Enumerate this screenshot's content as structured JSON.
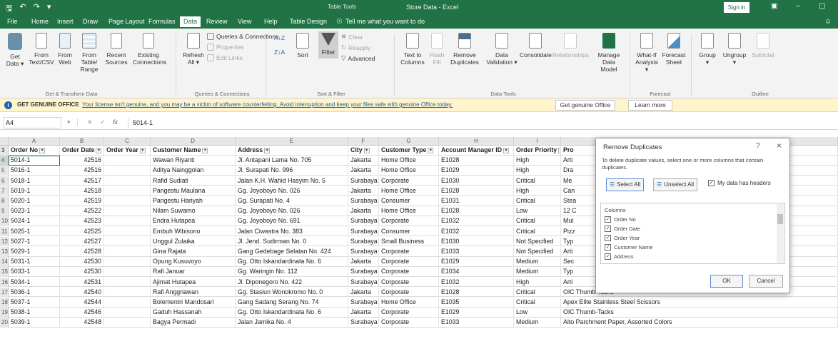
{
  "titlebar": {
    "table_tools": "Table Tools",
    "title": "Store Data - Excel",
    "sign_in": "Sign in"
  },
  "tabs": [
    "File",
    "Home",
    "Insert",
    "Draw",
    "Page Layout",
    "Formulas",
    "Data",
    "Review",
    "View",
    "Help",
    "Table Design"
  ],
  "active_tab": "Data",
  "tell_me": "Tell me what you want to do",
  "ribbon": {
    "get_data": "Get Data",
    "from_text": "From Text/CSV",
    "from_web": "From Web",
    "from_table": "From Table/ Range",
    "recent_sources": "Recent Sources",
    "existing_conn": "Existing Connections",
    "group_get": "Get & Transform Data",
    "refresh_all": "Refresh All",
    "queries_conn": "Queries & Connections",
    "properties": "Properties",
    "edit_links": "Edit Links",
    "group_queries": "Queries & Connections",
    "sort": "Sort",
    "filter": "Filter",
    "clear": "Clear",
    "reapply": "Reapply",
    "advanced": "Advanced",
    "group_sort": "Sort & Filter",
    "text_to_columns": "Text to Columns",
    "flash_fill": "Flash Fill",
    "remove_duplicates": "Remove Duplicates",
    "data_validation": "Data Validation",
    "consolidate": "Consolidate",
    "relationships": "Relationships",
    "manage_model": "Manage Data Model",
    "group_tools": "Data Tools",
    "what_if": "What-If Analysis",
    "forecast_sheet": "Forecast Sheet",
    "group_forecast": "Forecast",
    "group_btn": "Group",
    "ungroup": "Ungroup",
    "subtotal": "Subtotal",
    "group_outline": "Outline"
  },
  "message_bar": {
    "label": "GET GENUINE OFFICE",
    "text": "Your license isn't genuine, and you may be a victim of software counterfeiting. Avoid interruption and keep your files safe with genuine Office today.",
    "btn_genuine": "Get genuine Office",
    "btn_learn": "Learn more"
  },
  "formula_bar": {
    "name_box": "A4",
    "fx": "fx",
    "value": "5014-1"
  },
  "column_letters": [
    "A",
    "B",
    "C",
    "D",
    "E",
    "F",
    "G",
    "H",
    "I",
    "J"
  ],
  "headers": [
    "Order No",
    "Order Date",
    "Order Year",
    "Customer Name",
    "Address",
    "City",
    "Customer Type",
    "Account Manager ID",
    "Order Priority",
    "Pro"
  ],
  "rows": [
    {
      "n": "4",
      "c": [
        "5014-1",
        "42516",
        "",
        "Wawan Riyanti",
        "Jl. Antapani Lama No. 705",
        "Jakarta",
        "Home Office",
        "E1028",
        "High",
        "Arti"
      ]
    },
    {
      "n": "5",
      "c": [
        "5016-1",
        "42516",
        "",
        "Aditya Nainggolan",
        "Jl. Surapati No. 996",
        "Jakarta",
        "Home Office",
        "E1029",
        "High",
        "Dra"
      ]
    },
    {
      "n": "6",
      "c": [
        "5018-1",
        "42517",
        "",
        "Rafid Sudiati",
        "Jalan K.H. Wahid Hasyim No. 5",
        "Surabaya",
        "Corporate",
        "E1030",
        "Critical",
        "Me"
      ]
    },
    {
      "n": "7",
      "c": [
        "5019-1",
        "42518",
        "",
        "Pangestu Maulana",
        "Gg. Joyoboyo No. 026",
        "Jakarta",
        "Home Office",
        "E1028",
        "High",
        "Can"
      ]
    },
    {
      "n": "8",
      "c": [
        "5020-1",
        "42519",
        "",
        "Pangestu Hariyah",
        "Gg. Surapati No. 4",
        "Surabaya",
        "Consumer",
        "E1031",
        "Critical",
        "Stea"
      ]
    },
    {
      "n": "9",
      "c": [
        "5023-1",
        "42522",
        "",
        "Nilam Suwarno",
        "Gg. Joyoboyo No. 026",
        "Jakarta",
        "Home Office",
        "E1028",
        "Low",
        "12 C"
      ]
    },
    {
      "n": "10",
      "c": [
        "5024-1",
        "42523",
        "",
        "Endra Hutapea",
        "Gg. Joyoboyo No. 691",
        "Surabaya",
        "Corporate",
        "E1032",
        "Critical",
        "Mul"
      ]
    },
    {
      "n": "11",
      "c": [
        "5025-1",
        "42525",
        "",
        "Embuh Wibisono",
        "Jalan Ciwastra No. 383",
        "Surabaya",
        "Consumer",
        "E1032",
        "Critical",
        "Pizz"
      ]
    },
    {
      "n": "12",
      "c": [
        "5027-1",
        "42527",
        "",
        "Unggul Zulaika",
        "Jl. Jend. Sudirman No. 0",
        "Surabaya",
        "Small Business",
        "E1030",
        "Not Specified",
        "Typ"
      ]
    },
    {
      "n": "13",
      "c": [
        "5029-1",
        "42528",
        "",
        "Gina Rajata",
        "Gang Gedebage Selatan No. 424",
        "Surabaya",
        "Corporate",
        "E1033",
        "Not Specified",
        "Arti"
      ]
    },
    {
      "n": "14",
      "c": [
        "5031-1",
        "42530",
        "",
        "Opung Kusuvoyo",
        "Gg. Otto Iskandardinata No. 6",
        "Jakarta",
        "Corporate",
        "E1029",
        "Medium",
        "Sec"
      ]
    },
    {
      "n": "15",
      "c": [
        "5033-1",
        "42530",
        "",
        "Rafi Januar",
        "Gg. Waringin No. 112",
        "Surabaya",
        "Corporate",
        "E1034",
        "Medium",
        "Typ"
      ]
    },
    {
      "n": "16",
      "c": [
        "5034-1",
        "42531",
        "",
        "Ajimat Hutapea",
        "Jl. Diponegoro No. 422",
        "Surabaya",
        "Corporate",
        "E1032",
        "High",
        "Arti"
      ]
    },
    {
      "n": "17",
      "c": [
        "5036-1",
        "42540",
        "",
        "Rafi Anggriawan",
        "Gg. Stasiun Wonokromo No. 0",
        "Jakarta",
        "Corporate",
        "E1028",
        "Critical",
        "OIC Thumb-Tacks"
      ]
    },
    {
      "n": "18",
      "c": [
        "5037-1",
        "42544",
        "",
        "Bolementri Mandosari",
        "Gang Sadang Serang No. 74",
        "Surabaya",
        "Home Office",
        "E1035",
        "Critical",
        "Apex Elite Stainless Steel Scissors"
      ]
    },
    {
      "n": "19",
      "c": [
        "5038-1",
        "42546",
        "",
        "Gaduh Hassanah",
        "Gg. Otto Iskandardinata No. 6",
        "Jakarta",
        "Corporate",
        "E1029",
        "Low",
        "OIC Thumb-Tacks"
      ]
    },
    {
      "n": "20",
      "c": [
        "5039-1",
        "42548",
        "",
        "Bagya Permadi",
        "Jalan Jamika No. 4",
        "Surabaya",
        "Corporate",
        "E1033",
        "Medium",
        "Alto Parchment Paper, Assorted Colors"
      ]
    }
  ],
  "dialog": {
    "title": "Remove Duplicates",
    "help": "?",
    "close": "×",
    "description": "To delete duplicate values, select one or more columns that contain duplicates.",
    "select_all": "Select All",
    "unselect_all": "Unselect All",
    "has_headers": "My data has headers",
    "columns_label": "Columns",
    "columns": [
      "Order No",
      "Order Date",
      "Order Year",
      "Customer Name",
      "Address"
    ],
    "ok": "OK",
    "cancel": "Cancel"
  },
  "colors": {
    "excel_green": "#217346",
    "message_bar": "#fff4cc",
    "link": "#1f5fa8"
  }
}
